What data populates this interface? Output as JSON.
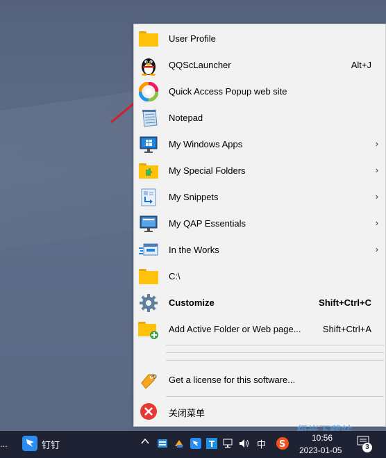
{
  "menu": {
    "items": [
      {
        "label": "User Profile",
        "shortcut": "",
        "submenu": false,
        "icon": "folder-icon"
      },
      {
        "label": "QQScLauncher",
        "shortcut": "Alt+J",
        "submenu": false,
        "icon": "qq-penguin-icon"
      },
      {
        "label": "Quick Access Popup web site",
        "shortcut": "",
        "submenu": false,
        "icon": "qap-swirl-icon"
      },
      {
        "label": "Notepad",
        "shortcut": "",
        "submenu": false,
        "icon": "notepad-icon"
      },
      {
        "label": "My Windows Apps",
        "shortcut": "",
        "submenu": true,
        "icon": "monitor-windows-icon"
      },
      {
        "label": "My Special Folders",
        "shortcut": "",
        "submenu": true,
        "icon": "special-folder-icon"
      },
      {
        "label": "My Snippets",
        "shortcut": "",
        "submenu": true,
        "icon": "snippet-icon"
      },
      {
        "label": "My QAP Essentials",
        "shortcut": "",
        "submenu": true,
        "icon": "monitor-icon"
      },
      {
        "label": "In the Works",
        "shortcut": "",
        "submenu": true,
        "icon": "works-icon"
      },
      {
        "label": "C:\\",
        "shortcut": "",
        "submenu": false,
        "icon": "folder-icon"
      },
      {
        "label": "Customize",
        "shortcut": "Shift+Ctrl+C",
        "submenu": false,
        "icon": "gear-icon"
      },
      {
        "label": "Add Active Folder or Web page...",
        "shortcut": "Shift+Ctrl+A",
        "submenu": false,
        "icon": "add-folder-icon"
      }
    ],
    "license": "Get a license for this software...",
    "close": "关闭菜单",
    "arrow_glyph": "›"
  },
  "taskbar": {
    "overflow": "...",
    "app_label": "钉钉",
    "ime": "中",
    "time": "10:56",
    "date": "2023-01-05",
    "notification_count": "3"
  },
  "watermark": "极光下载站",
  "colors": {
    "folder": "#ffc10a",
    "arrow": "#d21f26",
    "close": "#e53935",
    "taskbar": "#1e2233"
  }
}
